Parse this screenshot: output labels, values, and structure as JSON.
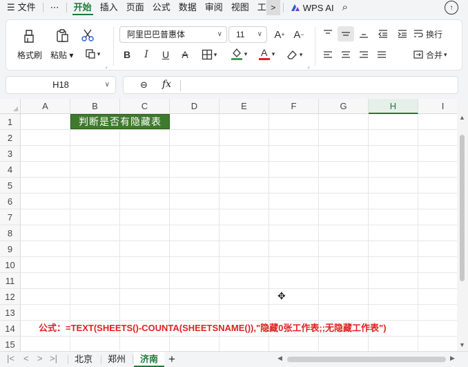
{
  "menu": {
    "file_label": "文件",
    "more_label": "⋯",
    "tabs": [
      "开始",
      "插入",
      "页面",
      "公式",
      "数据",
      "审阅",
      "视图",
      "工"
    ],
    "wps_ai_label": "WPS AI"
  },
  "ribbon": {
    "format_painter_label": "格式刷",
    "paste_label": "粘贴",
    "font_name": "阿里巴巴普惠体",
    "font_size": "11",
    "wrap_label": "换行",
    "merge_label": "合并"
  },
  "name_box": {
    "value": "H18"
  },
  "formula_bar": {
    "fx_label": "fx",
    "value": ""
  },
  "grid": {
    "columns": [
      "A",
      "B",
      "C",
      "D",
      "E",
      "F",
      "G",
      "H",
      "I"
    ],
    "selected_column": "H",
    "rows": [
      "1",
      "2",
      "3",
      "4",
      "5",
      "6",
      "7",
      "8",
      "9",
      "10",
      "11",
      "12",
      "13",
      "14",
      "15"
    ],
    "title_cell_text": "判断是否有隐藏表",
    "formula_note": "公式：=TEXT(SHEETS()-COUNTA(SHEETSNAME()),\"隐藏0张工作表;;无隐藏工作表\")"
  },
  "sheets": {
    "tabs": [
      "北京",
      "郑州",
      "济南"
    ],
    "active": "济南",
    "add_label": "+"
  },
  "colors": {
    "accent": "#1f7a3a",
    "title_cell_bg": "#3e7a2c",
    "note_red": "#e02020"
  }
}
